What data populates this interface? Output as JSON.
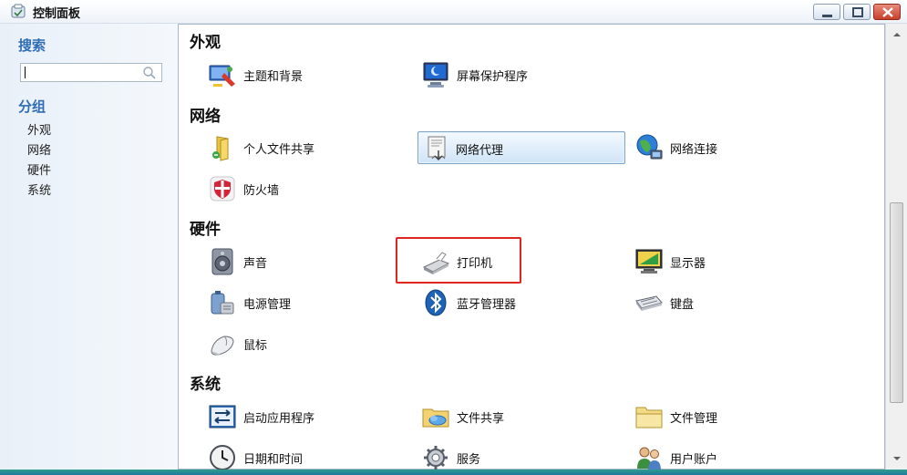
{
  "window": {
    "title": "控制面板"
  },
  "sidebar": {
    "search_heading": "搜索",
    "search_value": "",
    "group_heading": "分组",
    "links": [
      "外观",
      "网络",
      "硬件",
      "系统"
    ]
  },
  "sections": {
    "appearance": {
      "title": "外观",
      "items": [
        "主题和背景",
        "屏幕保护程序"
      ]
    },
    "network": {
      "title": "网络",
      "items": [
        "个人文件共享",
        "网络代理",
        "网络连接",
        "防火墙"
      ]
    },
    "hardware": {
      "title": "硬件",
      "items": [
        "声音",
        "打印机",
        "显示器",
        "电源管理",
        "蓝牙管理器",
        "键盘",
        "鼠标"
      ]
    },
    "system": {
      "title": "系统",
      "items": [
        "启动应用程序",
        "文件共享",
        "文件管理",
        "日期和时间",
        "服务",
        "用户账户"
      ]
    }
  },
  "state": {
    "selected_item": "网络代理",
    "highlighted_item": "打印机"
  },
  "colors": {
    "accent": "#2f6db5",
    "highlight": "#e0261f",
    "selection": "#cfe4f7"
  }
}
